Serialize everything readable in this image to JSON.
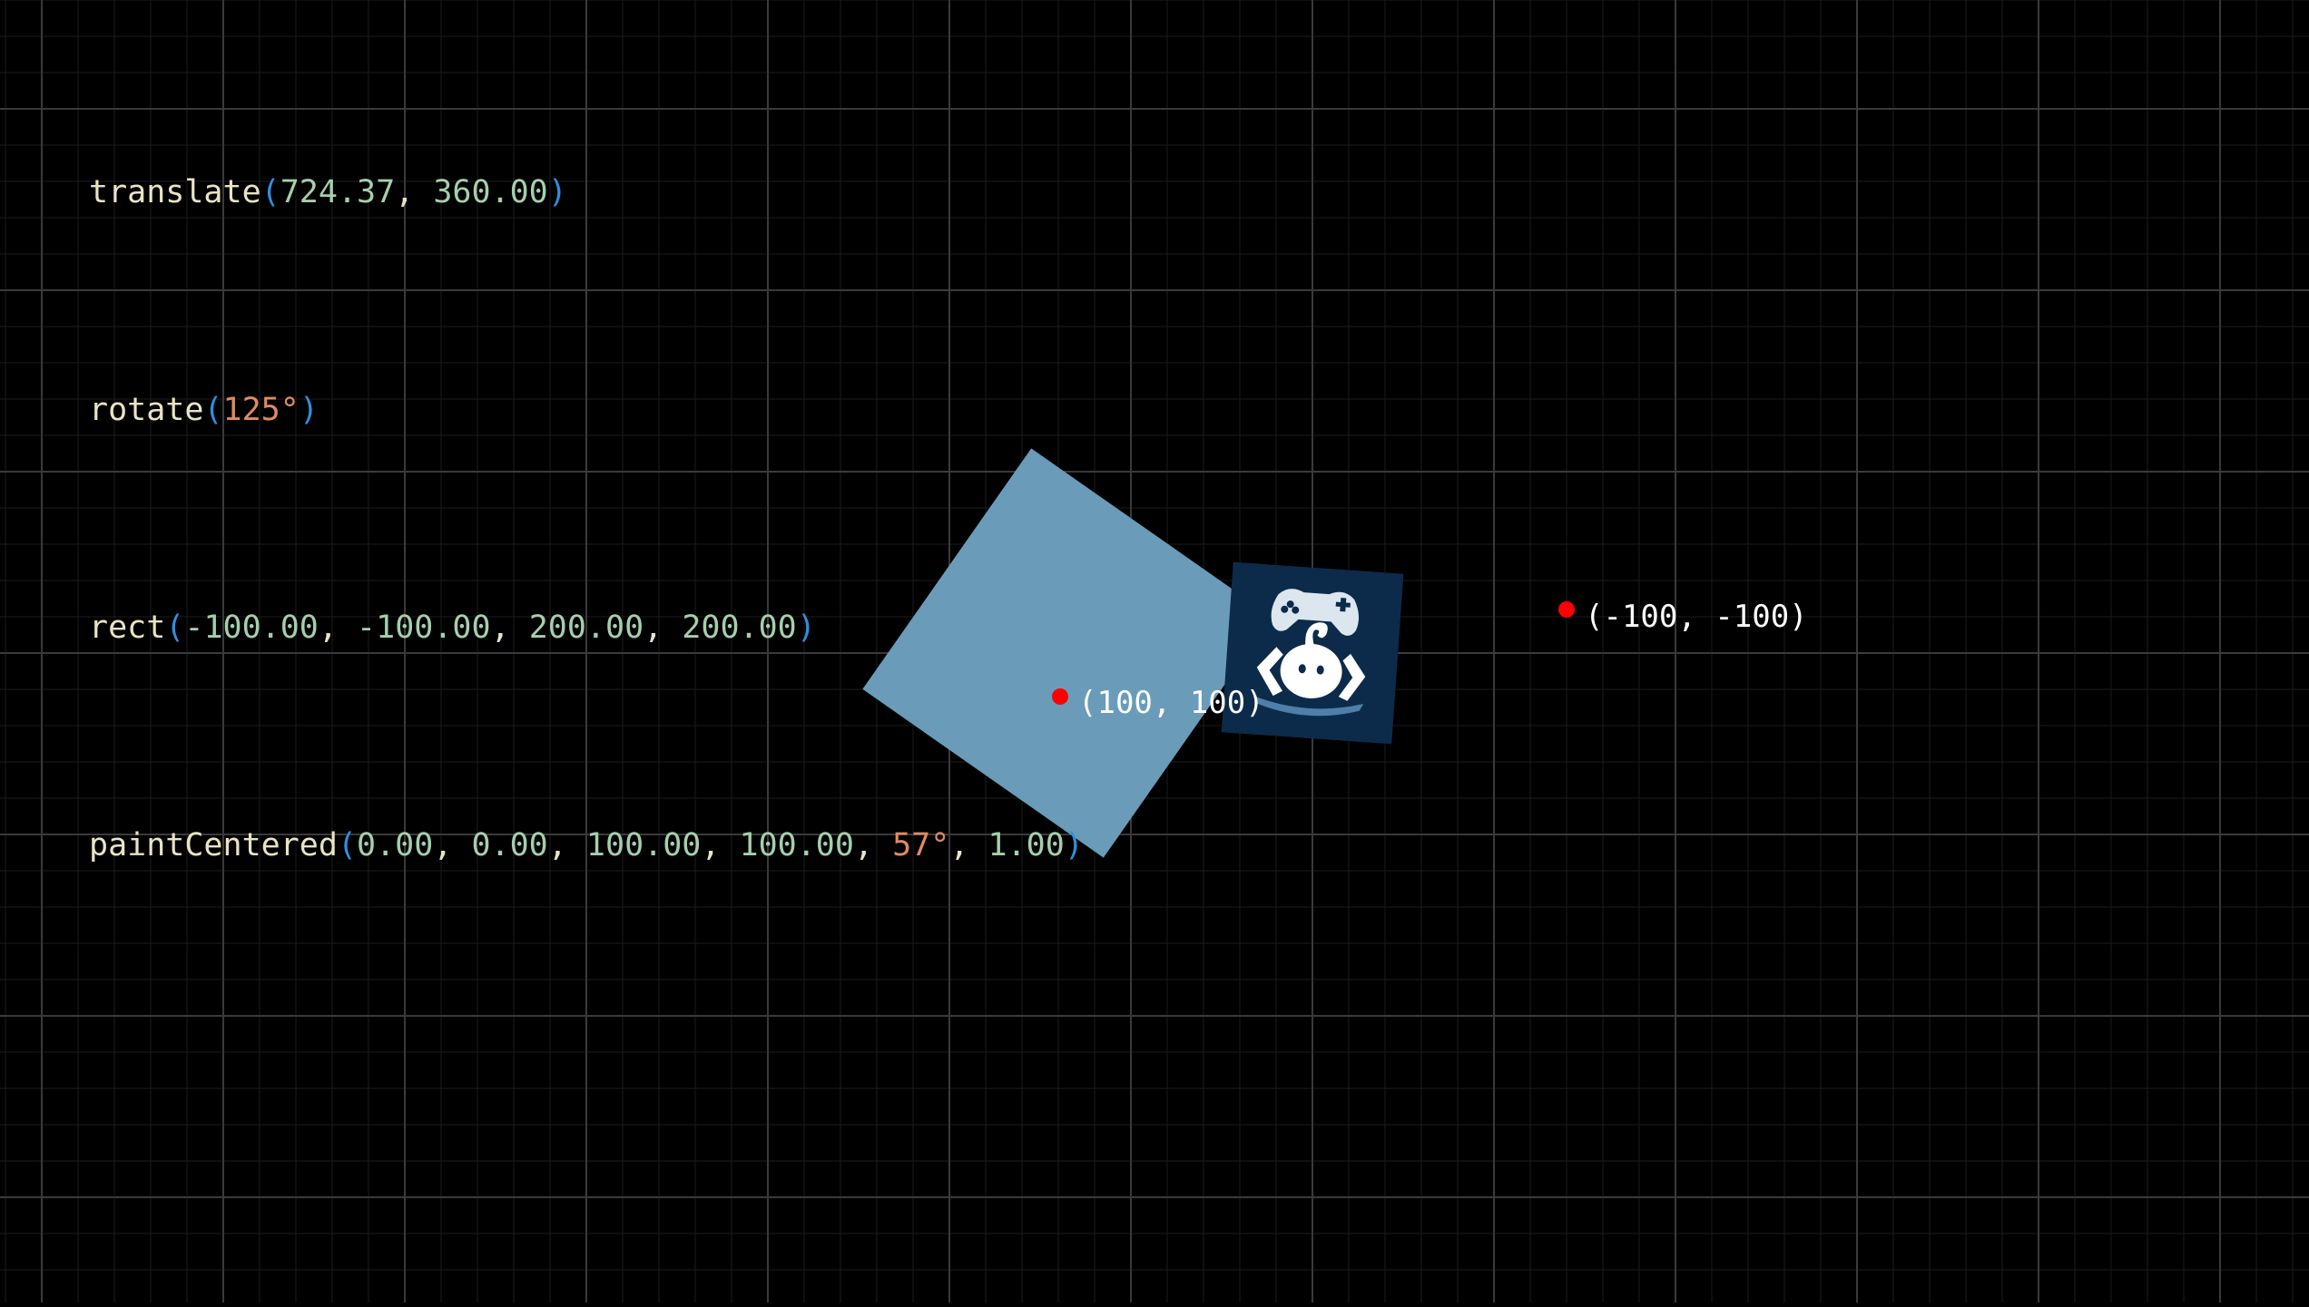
{
  "code": {
    "translate": {
      "fn": "translate",
      "args": [
        "724.37",
        "360.00"
      ]
    },
    "rotate": {
      "fn": "rotate",
      "angle": "125°"
    },
    "rect": {
      "fn": "rect",
      "args": [
        "-100.00",
        "-100.00",
        "200.00",
        "200.00"
      ]
    },
    "paint_centered": {
      "fn": "paintCentered",
      "args": [
        "0.00",
        "0.00",
        "100.00",
        "100.00"
      ],
      "angle": "57°",
      "scale": "1.00"
    }
  },
  "markers": {
    "corner_a_label": "(100, 100)",
    "corner_b_label": "(-100, -100)"
  },
  "icon": {
    "name": "game-controller-mascot-icon"
  },
  "colors": {
    "background": "#000000",
    "grid_minor": "#1c1c1c",
    "grid_major": "#3a3a3a",
    "rect_fill": "#6a9cba",
    "image_bg": "#0c2b4b",
    "marker": "#ff0000",
    "label": "#ffffff",
    "code_function": "#e8e4c4",
    "code_paren": "#2f8fe0",
    "code_number": "#a5cfae",
    "code_angle": "#e08a63"
  }
}
